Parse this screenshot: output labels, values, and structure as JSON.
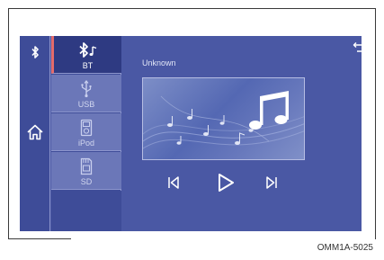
{
  "rail": {
    "bluetooth_icon": "bluetooth-icon",
    "home_icon": "home-icon"
  },
  "sources": [
    {
      "label": "BT",
      "icon": "bluetooth-audio-icon",
      "active": true
    },
    {
      "label": "USB",
      "icon": "usb-icon",
      "active": false
    },
    {
      "label": "iPod",
      "icon": "ipod-icon",
      "active": false
    },
    {
      "label": "SD",
      "icon": "sd-card-icon",
      "active": false
    }
  ],
  "player": {
    "track_title": "Unknown",
    "album_art": "music-notes-artwork",
    "controls": [
      "previous-icon",
      "play-icon",
      "next-icon"
    ]
  },
  "caption": "OMM1A-5025",
  "colors": {
    "screen_bg": "#4a58a4",
    "panel_bg": "#3e4c98",
    "inactive_source_bg": "#6b77b8",
    "active_source_bg": "#2e3a82",
    "active_accent": "#e56b6b"
  }
}
